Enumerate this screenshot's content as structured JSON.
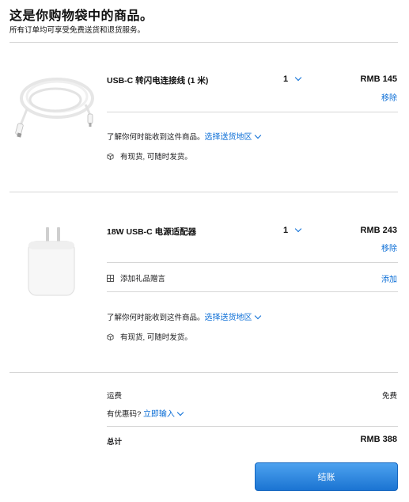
{
  "header": {
    "title": "这是你购物袋中的商品。",
    "subtitle": "所有订单均可享受免费送货和退货服务。"
  },
  "items": [
    {
      "name": "USB-C 转闪电连接线 (1 米)",
      "qty": "1",
      "price": "RMB 145",
      "remove": "移除",
      "delivery_text": "了解你何时能收到这件商品。",
      "delivery_link": "选择送货地区",
      "stock": "有现货, 可随时发货。"
    },
    {
      "name": "18W USB-C 电源适配器",
      "qty": "1",
      "price": "RMB 243",
      "remove": "移除",
      "gift_label": "添加礼品赠言",
      "gift_link": "添加",
      "delivery_text": "了解你何时能收到这件商品。",
      "delivery_link": "选择送货地区",
      "stock": "有现货, 可随时发货。"
    }
  ],
  "summary": {
    "shipping_label": "运费",
    "shipping_value": "免费",
    "promo_label": "有优惠码?",
    "promo_link": "立即输入",
    "total_label": "总计",
    "total_value": "RMB 388",
    "checkout": "结账"
  },
  "colors": {
    "link": "#0a6dd6",
    "button": "#1b74d2",
    "divider": "#d6d6d6"
  }
}
